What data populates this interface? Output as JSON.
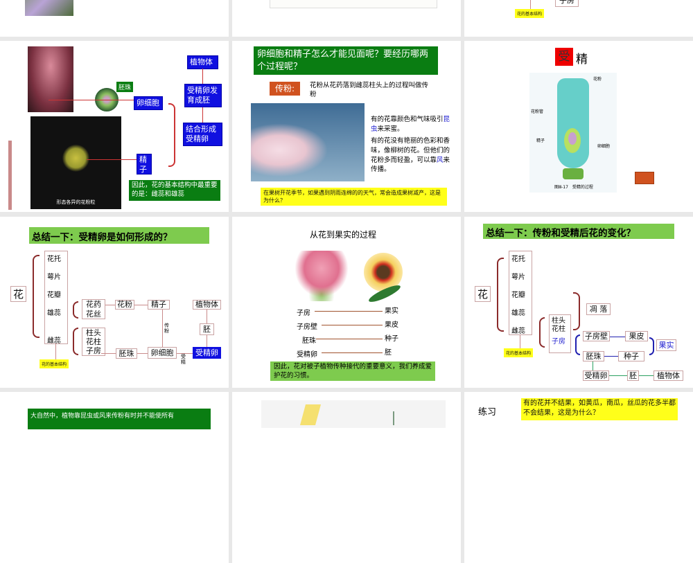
{
  "slides": {
    "s1": {},
    "s2": {},
    "s3": {
      "label_zifang": "子房",
      "basic_structure": "花的基本结构"
    },
    "s4": {
      "embryo_ball": "胚珠",
      "egg_cell": "卵细胞",
      "sperm": "精子",
      "combine": "结合形成受精卵",
      "develop": "受精卵发育成胚",
      "plant": "植物体",
      "pollen_caption": "形态各异的花粉粒",
      "conclusion": "因此，花的基本结构中最重要的是：雌蕊和雄蕊"
    },
    "s5": {
      "title": "卵细胞和精子怎么才能见面呢？要经历哪两个过程呢？",
      "pollination_label": "传粉:",
      "pollination_def": "花粉从花药落到雌蕊柱头上的过程叫做传粉",
      "text1_a": "有的花靠颜色和气味吸引",
      "text1_b": "昆虫",
      "text1_c": "来采蜜。",
      "text2_a": "有的花没有艳丽的色彩和香味，像柳树的花。但他们的花粉多而轻盈，可以靠",
      "text2_b": "风",
      "text2_c": "来传播。",
      "question": "在果树开花季节，如果遇到阴雨连绵的的天气，常会造成果树减产，这是为什么？"
    },
    "s6": {
      "title_red": "受",
      "title_rest": "精",
      "l_pollen": "花粉",
      "l_tube": "花粉管",
      "l_sperm": "精子",
      "l_egg": "卵细胞",
      "caption": "图Ⅲ-17　受精的过程"
    },
    "s7": {
      "title": "总结一下：受精卵是如何形成的？",
      "flower": "花",
      "parts": [
        "花托",
        "萼片",
        "花瓣",
        "雄蕊",
        "雌蕊"
      ],
      "stamen_parts": "花药花丝",
      "pistil_parts": "柱头花柱子房",
      "pollen": "花粉",
      "sperm": "精子",
      "ovule": "胚珠",
      "egg": "卵细胞",
      "zygote": "受精卵",
      "embryo": "胚",
      "plant": "植物体",
      "pollination": "传粉",
      "fertilization": "受精",
      "basic_structure": "花的基本结构"
    },
    "s8": {
      "title": "从花到果实的过程",
      "rows": [
        {
          "from": "子房",
          "to": "果实"
        },
        {
          "from": "子房壁",
          "to": "果皮"
        },
        {
          "from": "胚珠",
          "to": "种子"
        },
        {
          "from": "受精卵",
          "to": "胚"
        }
      ],
      "conclusion": "因此，花对被子植物传种接代的重要意义，我们养成爱护花的习惯。"
    },
    "s9": {
      "title": "总结一下：传粉和受精后花的变化？",
      "flower": "花",
      "parts": [
        "花托",
        "萼片",
        "花瓣",
        "雄蕊",
        "雌蕊"
      ],
      "pistil_a": "柱头",
      "pistil_b": "花柱",
      "ovary": "子房",
      "wither": "凋 落",
      "ovary_wall": "子房壁",
      "peel": "果皮",
      "ovule": "胚珠",
      "seed": "种子",
      "fruit": "果实",
      "zygote": "受精卵",
      "embryo": "胚",
      "plant": "植物体",
      "basic_structure": "花的基本结构"
    },
    "s10": {
      "text": "大自然中，植物靠昆虫或风来传粉有时并不能使所有"
    },
    "s12": {
      "label": "练习",
      "question": "有的花并不结果，如黄瓜，南瓜，丝瓜的花多半都不会结果，这是为什么？"
    }
  }
}
